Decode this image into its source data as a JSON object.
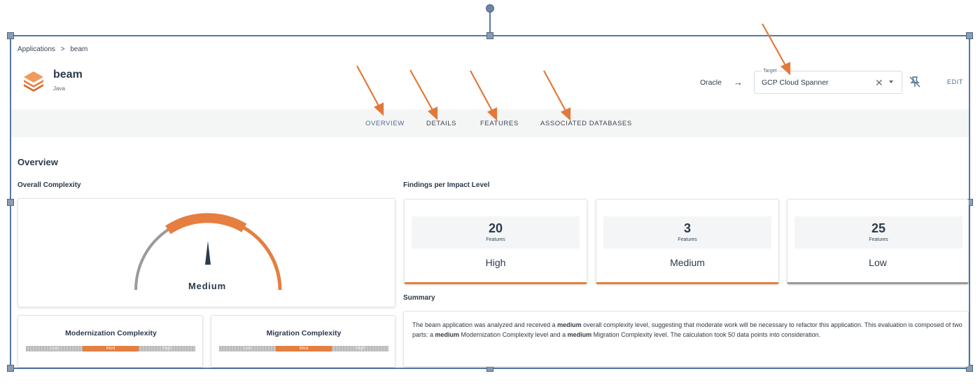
{
  "breadcrumb": {
    "root": "Applications",
    "separator": ">",
    "current": "beam"
  },
  "app": {
    "name": "beam",
    "language": "Java",
    "icon": "layers-icon"
  },
  "migration": {
    "source": "Oracle",
    "arrow": "→",
    "target_label": "Target",
    "target_value": "GCP Cloud Spanner",
    "edit_label": "EDIT"
  },
  "tabs": [
    {
      "label": "OVERVIEW",
      "active": true
    },
    {
      "label": "DETAILS",
      "active": false
    },
    {
      "label": "FEATURES",
      "active": false
    },
    {
      "label": "ASSOCIATED DATABASES",
      "active": false
    }
  ],
  "overview": {
    "heading": "Overview",
    "complexity_title": "Overall Complexity",
    "gauge": {
      "label": "Medium",
      "level": "Medium"
    },
    "modernization": {
      "title": "Modernization Complexity",
      "segments": [
        "Low",
        "Med",
        "High"
      ],
      "active": "Med"
    },
    "migration": {
      "title": "Migration Complexity",
      "segments": [
        "Low",
        "Med",
        "High"
      ],
      "active": "Med"
    }
  },
  "findings": {
    "title": "Findings per Impact Level",
    "cards": [
      {
        "count": "20",
        "unit": "Features",
        "level": "High"
      },
      {
        "count": "3",
        "unit": "Features",
        "level": "Medium"
      },
      {
        "count": "25",
        "unit": "Features",
        "level": "Low"
      }
    ]
  },
  "summary": {
    "title": "Summary",
    "text_1": "The beam application was analyzed and received a ",
    "bold_1": "medium",
    "text_2": " overall complexity level, suggesting that moderate work will be necessary to refactor this application. This evaluation is composed of two parts: a ",
    "bold_2": "medium",
    "text_3": " Modernization Complexity level and a ",
    "bold_3": "medium",
    "text_4": " Migration Complexity level. The calculation took 50 data points into consideration."
  },
  "colors": {
    "accent": "#e57e3f",
    "frame": "#5478a6",
    "text": "#2c3a4a",
    "arrow": "#e07a3a"
  }
}
